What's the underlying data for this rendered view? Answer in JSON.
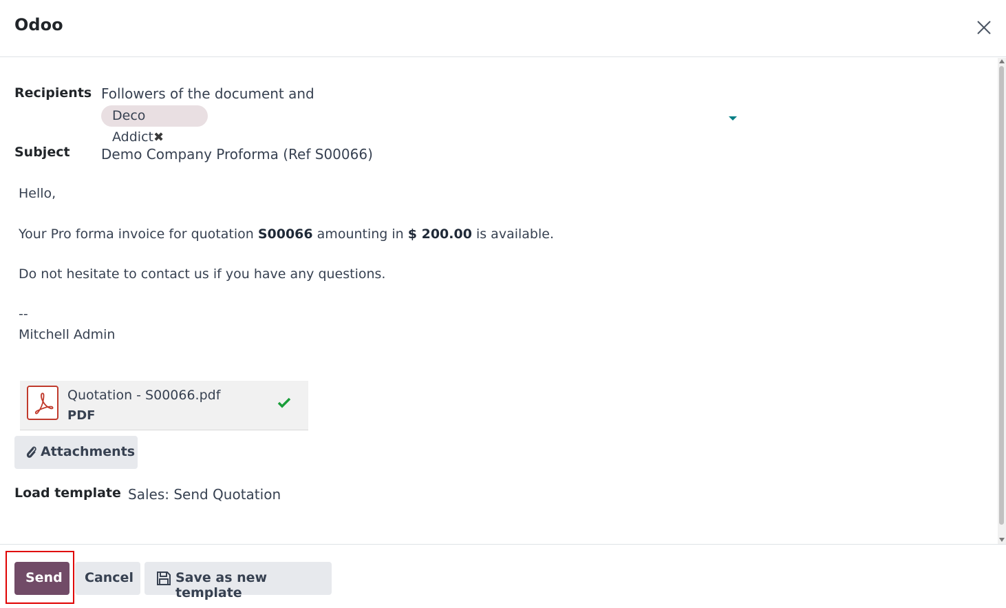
{
  "dialog": {
    "title": "Odoo"
  },
  "recipients": {
    "label": "Recipients",
    "prefix": "Followers of the document and",
    "tags": [
      {
        "name": "Deco Addict",
        "remove_glyph": "✖"
      }
    ]
  },
  "subject": {
    "label": "Subject",
    "value": "Demo Company Proforma (Ref S00066)"
  },
  "message": {
    "greeting": "Hello,",
    "line_part1": "Your Pro forma invoice for quotation ",
    "quote_ref": "S00066",
    "line_part2": " amounting in ",
    "amount": "$ 200.00",
    "line_part3": " is available.",
    "contact_line": "Do not hesitate to contact us if you have any questions.",
    "sig_sep": "--",
    "signature": "Mitchell Admin"
  },
  "attachments": [
    {
      "name": "Quotation - S00066.pdf",
      "type": "PDF",
      "icon": "pdf-file-icon",
      "status_icon": "check-icon"
    }
  ],
  "attach_button": {
    "label": "Attachments",
    "icon": "paperclip-icon"
  },
  "template": {
    "label": "Load template",
    "value": "Sales: Send Quotation"
  },
  "footer": {
    "send_label": "Send",
    "cancel_label": "Cancel",
    "save_template_label": "Save as new template",
    "save_icon": "floppy-disk-icon"
  },
  "colors": {
    "primary": "#714b67",
    "caret": "#017e84",
    "check": "#1a9e3a",
    "pdf_red": "#c0392b",
    "highlight": "#e00000"
  }
}
